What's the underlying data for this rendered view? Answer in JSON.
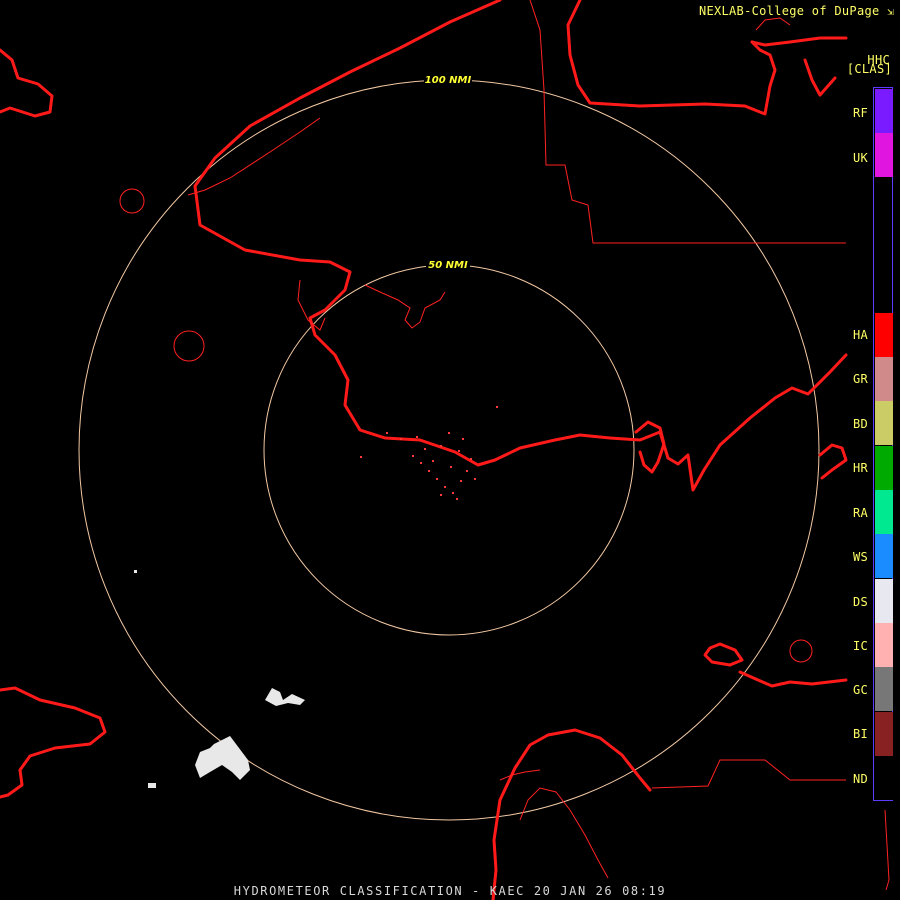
{
  "header": {
    "credit": "NEXLAB-College of DuPage",
    "credit_icon": "arrow-corner-icon",
    "product_code": "HHC",
    "group_code": "[CLAS]"
  },
  "footer": {
    "caption": "HYDROMETEOR CLASSIFICATION - KAEC 20 JAN 26 08:19"
  },
  "range_rings": [
    {
      "label": "50 NMI"
    },
    {
      "label": "100 NMI"
    }
  ],
  "colors": {
    "background": "#000000",
    "coastline": "#ff1a1a",
    "range_ring": "#f3c9a4",
    "label_text": "#ffff66",
    "echo": "#e8e8e8"
  },
  "legend": {
    "items": [
      {
        "code": "RF",
        "color": "#7a1aff"
      },
      {
        "code": "UK",
        "color": "#e015e0"
      },
      {
        "code": "HA",
        "color": "#ff0000"
      },
      {
        "code": "GR",
        "color": "#d08a8a"
      },
      {
        "code": "BD",
        "color": "#cccc66"
      },
      {
        "code": "HR",
        "color": "#00aa00"
      },
      {
        "code": "RA",
        "color": "#00e890"
      },
      {
        "code": "WS",
        "color": "#1a8cff"
      },
      {
        "code": "DS",
        "color": "#e8e8f0"
      },
      {
        "code": "IC",
        "color": "#ffb0b0"
      },
      {
        "code": "GC",
        "color": "#777777"
      },
      {
        "code": "BI",
        "color": "#882222"
      },
      {
        "code": "ND",
        "color": "#000000"
      }
    ]
  }
}
